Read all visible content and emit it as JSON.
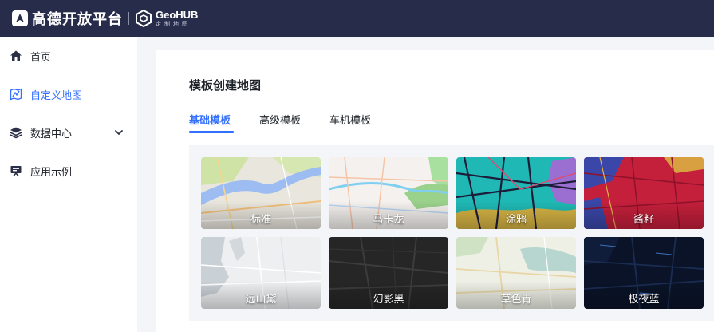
{
  "header": {
    "brand_name": "高德开放平台",
    "product_title": "GeoHUB",
    "product_subtitle": "定制地图"
  },
  "sidebar": {
    "items": [
      {
        "label": "首页",
        "icon": "home-icon"
      },
      {
        "label": "自定义地图",
        "icon": "custom-map-icon",
        "active": true
      },
      {
        "label": "数据中心",
        "icon": "layers-icon",
        "expandable": true
      },
      {
        "label": "应用示例",
        "icon": "screen-icon"
      }
    ]
  },
  "main": {
    "title": "模板创建地图",
    "tabs": [
      {
        "label": "基础模板",
        "active": true
      },
      {
        "label": "高级模板"
      },
      {
        "label": "车机模板"
      }
    ],
    "templates": [
      {
        "label": "标准",
        "style": "standard"
      },
      {
        "label": "马卡龙",
        "style": "macaron"
      },
      {
        "label": "涂鸦",
        "style": "graffiti"
      },
      {
        "label": "酱籽",
        "style": "jiangzi"
      },
      {
        "label": "远山黛",
        "style": "yuanshandai"
      },
      {
        "label": "幻影黑",
        "style": "phantom-black"
      },
      {
        "label": "草色青",
        "style": "grass-green"
      },
      {
        "label": "极夜蓝",
        "style": "polar-night-blue"
      }
    ]
  },
  "colors": {
    "topbar": "#272c4a",
    "accent": "#3370ff",
    "page_bg": "#f3f5f9"
  }
}
